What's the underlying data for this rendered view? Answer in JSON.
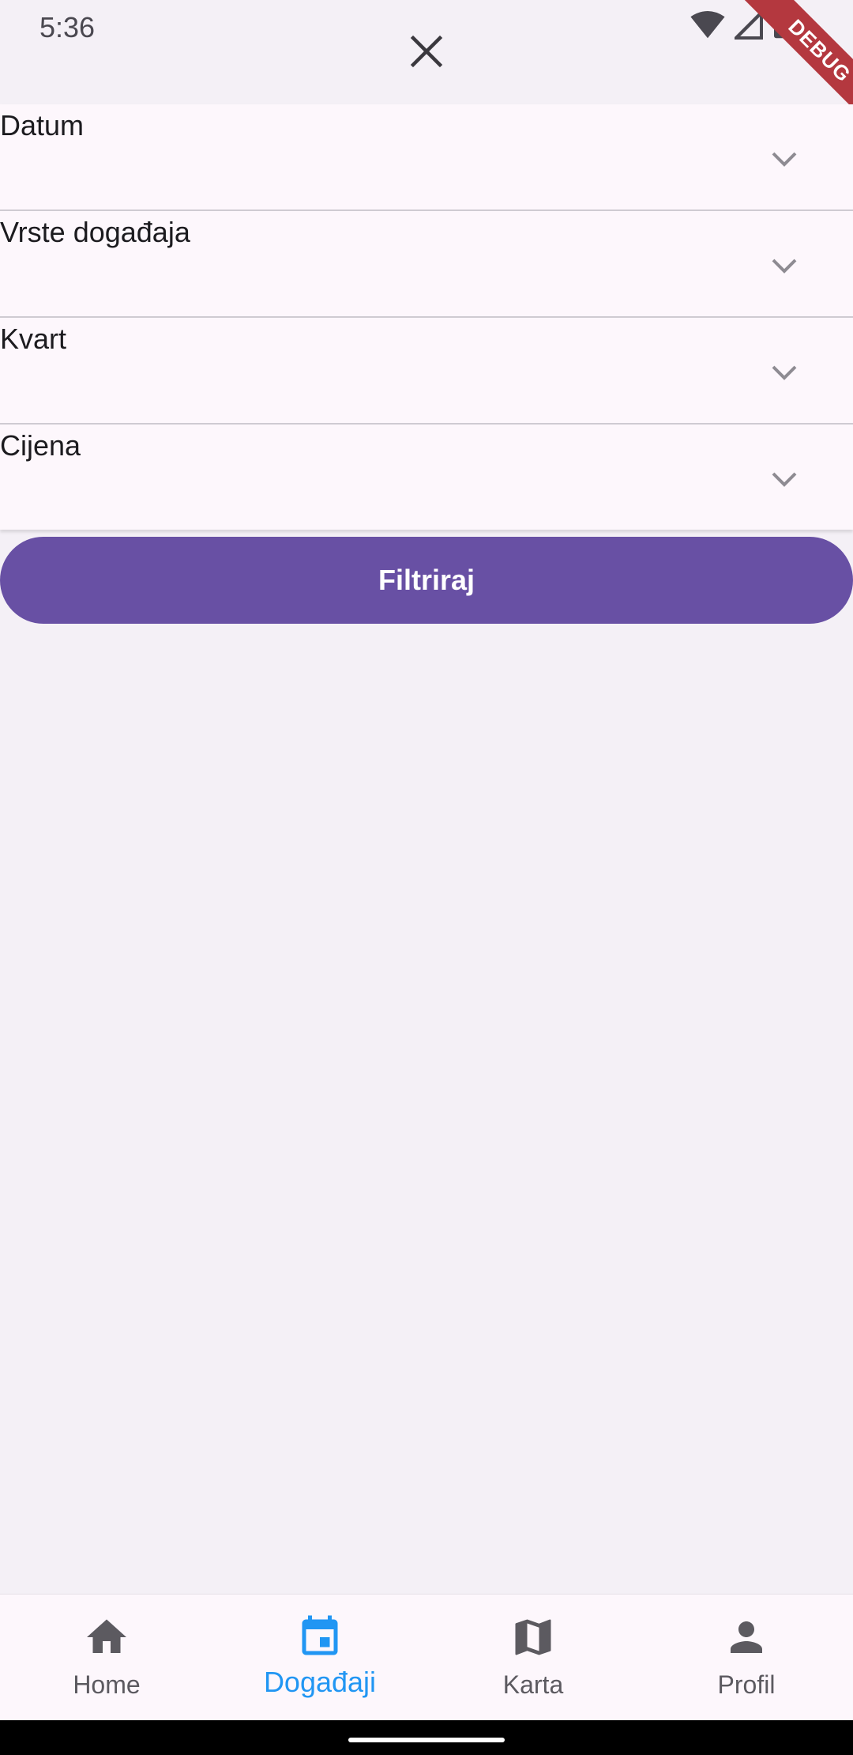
{
  "status_bar": {
    "time": "5:36"
  },
  "debug_banner": {
    "text": "DEBUG"
  },
  "filters": [
    {
      "label": "Datum"
    },
    {
      "label": "Vrste događaja"
    },
    {
      "label": "Kvart"
    },
    {
      "label": "Cijena"
    }
  ],
  "filter_button": {
    "label": "Filtriraj"
  },
  "bottom_nav": {
    "items": [
      {
        "label": "Home",
        "icon": "home-icon"
      },
      {
        "label": "Događaji",
        "icon": "calendar-icon",
        "active": true
      },
      {
        "label": "Karta",
        "icon": "map-icon"
      },
      {
        "label": "Profil",
        "icon": "person-icon"
      }
    ]
  },
  "colors": {
    "primary": "#6850a4",
    "nav_active": "#2196f3",
    "background": "#f4f0f6",
    "surface": "#fdf7fc",
    "debug": "#b4383f"
  }
}
